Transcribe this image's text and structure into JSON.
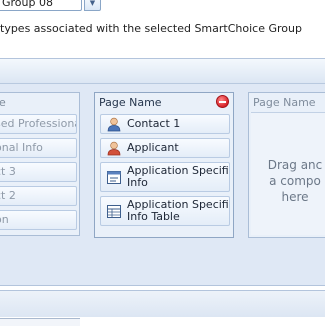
{
  "top": {
    "group_select_value": "Group 08",
    "description": "types associated with the selected SmartChoice Group"
  },
  "left_card": {
    "title": "e",
    "items": [
      {
        "label": "sed Professional",
        "icon": "person-icon"
      },
      {
        "label": "onal Info",
        "icon": "info-icon"
      },
      {
        "label": "ct 3",
        "icon": "person-icon"
      },
      {
        "label": "ct 2",
        "icon": "person-icon"
      },
      {
        "label": "on",
        "icon": "info-icon"
      }
    ]
  },
  "center_card": {
    "title": "Page Name",
    "items": [
      {
        "label": "Contact 1",
        "icon": "contact-person-icon"
      },
      {
        "label": "Applicant",
        "icon": "applicant-person-icon"
      },
      {
        "label_lines": [
          "Application Specific",
          "Info"
        ],
        "icon": "form-icon"
      },
      {
        "label_lines": [
          "Application Specific",
          "Info Table"
        ],
        "icon": "table-icon"
      }
    ]
  },
  "right_card": {
    "title": "Page Name",
    "drop_lines": [
      "Drag anc",
      "a compo",
      "here"
    ]
  },
  "colors": {
    "panel_bg": "#dfe8f5",
    "card_bg": "#e9f0f9",
    "close_red": "#d8232a"
  }
}
